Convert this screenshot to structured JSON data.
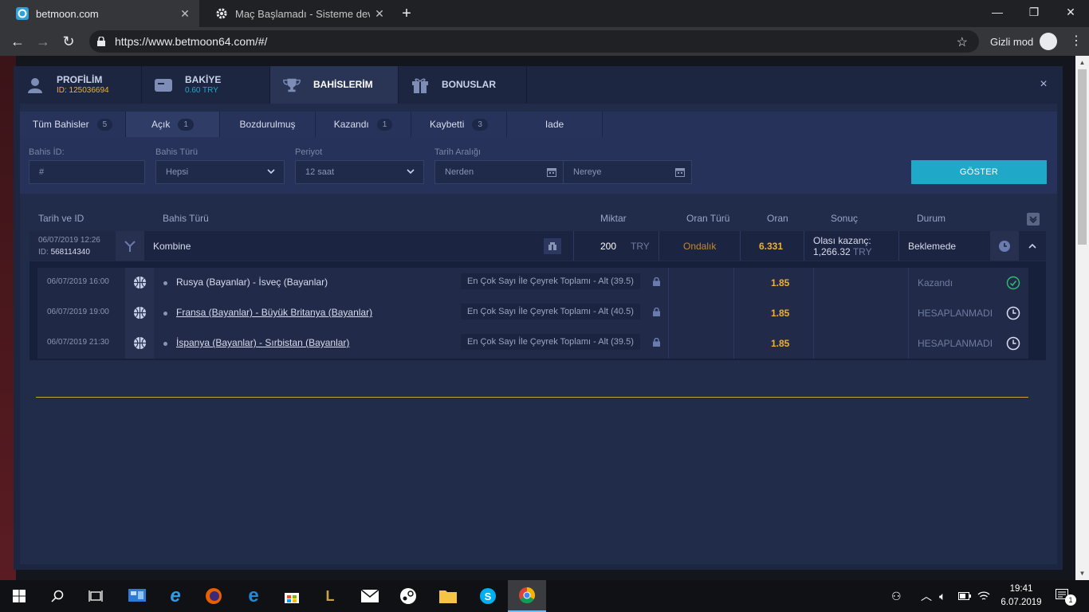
{
  "browser": {
    "tabs": [
      {
        "title": "betmoon.com",
        "active": true
      },
      {
        "title": "Maç Başlamadı - Sisteme devam",
        "active": false
      }
    ],
    "url": "https://www.betmoon64.com/#/",
    "incognito_label": "Gizli mod"
  },
  "modal": {
    "tabs": [
      {
        "label": "PROFİLİM",
        "sub": "ID: 125036694",
        "icon": "user-icon"
      },
      {
        "label": "BAKİYE",
        "sub": "0.60 TRY",
        "icon": "wallet-icon"
      },
      {
        "label": "BAHİSLERİM",
        "sub": "",
        "icon": "trophy-icon"
      },
      {
        "label": "BONUSLAR",
        "sub": "",
        "icon": "gift-icon"
      }
    ],
    "close": "×"
  },
  "filters": {
    "tabs": [
      {
        "label": "Tüm Bahisler",
        "count": "5"
      },
      {
        "label": "Açık",
        "count": "1"
      },
      {
        "label": "Bozdurulmuş",
        "count": ""
      },
      {
        "label": "Kazandı",
        "count": "1"
      },
      {
        "label": "Kaybetti",
        "count": "3"
      },
      {
        "label": "Iade",
        "count": ""
      }
    ],
    "bet_id_label": "Bahis İD:",
    "bet_id_placeholder": "#",
    "bet_type_label": "Bahis Türü",
    "bet_type_value": "Hepsi",
    "period_label": "Periyot",
    "period_value": "12 saat",
    "date_range_label": "Tarih Aralığı",
    "from_placeholder": "Nerden",
    "to_placeholder": "Nereye",
    "show_button": "GÖSTER"
  },
  "table": {
    "headers": {
      "date_id": "Tarih ve ID",
      "bet_type": "Bahis Türü",
      "amount": "Miktar",
      "odds_type": "Oran Türü",
      "odds": "Oran",
      "result": "Sonuç",
      "status": "Durum"
    },
    "main": {
      "date": "06/07/2019 12:26",
      "id_label": "ID:",
      "id": "568114340",
      "type": "Kombine",
      "amount": "200",
      "currency": "TRY",
      "odds_type": "Ondalık",
      "odds": "6.331",
      "possible_win_label": "Olası kazanç:",
      "possible_win": "1,266.32",
      "possible_win_currency": "TRY",
      "status": "Beklemede"
    },
    "selections": [
      {
        "date": "06/07/2019 16:00",
        "match": "Rusya (Bayanlar) - İsveç (Bayanlar)",
        "market": "En Çok Sayı İle Çeyrek Toplamı - Alt (39.5)",
        "odds": "1.85",
        "status": "Kazandı",
        "status_icon": "check-circle-icon",
        "link": false
      },
      {
        "date": "06/07/2019 19:00",
        "match": "Fransa (Bayanlar) - Büyük Britanya (Bayanlar)",
        "market": "En Çok Sayı İle Çeyrek Toplamı - Alt (40.5)",
        "odds": "1.85",
        "status": "HESAPLANMADI",
        "status_icon": "clock-icon",
        "link": true
      },
      {
        "date": "06/07/2019 21:30",
        "match": "İspanya (Bayanlar) - Sırbistan (Bayanlar)",
        "market": "En Çok Sayı İle Çeyrek Toplamı - Alt (39.5)",
        "odds": "1.85",
        "status": "HESAPLANMADI",
        "status_icon": "clock-icon",
        "link": true
      }
    ]
  },
  "taskbar": {
    "time": "19:41",
    "date": "6.07.2019",
    "notification_count": "1"
  },
  "colors": {
    "accent": "#1fa8c8",
    "odds": "#f0b030",
    "won": "#2fbf71"
  }
}
